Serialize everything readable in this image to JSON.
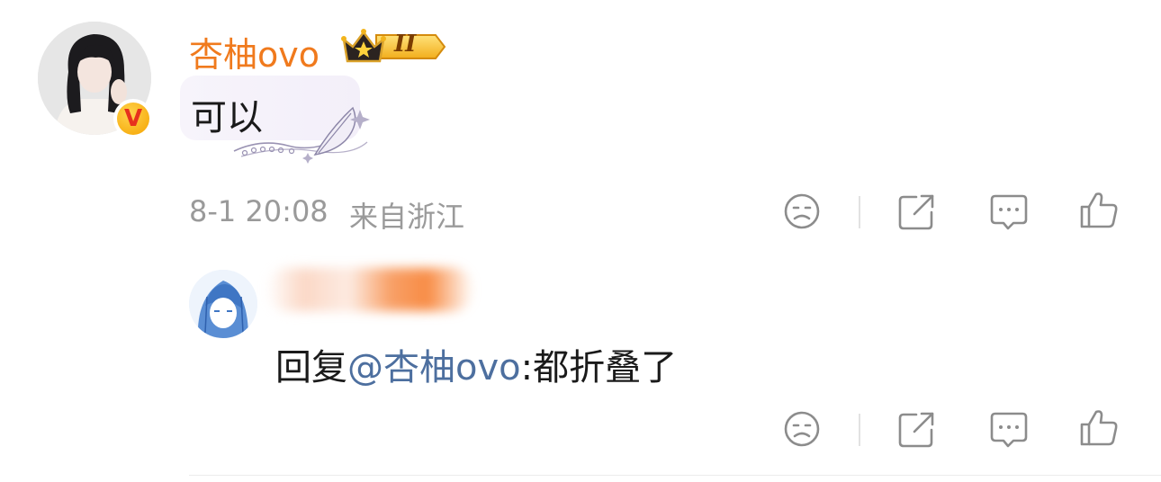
{
  "comment": {
    "author": "杏柚ovo",
    "rank_badge": "II",
    "vip_badge": "V",
    "text": "可以",
    "date": "8-1 20:08",
    "location": "来自浙江"
  },
  "reply": {
    "prefix": "回复",
    "mention": "@杏柚ovo",
    "text": ":都折叠了"
  },
  "actions": [
    "dislike-icon",
    "share-icon",
    "comment-icon",
    "like-icon"
  ],
  "colors": {
    "username": "#f07a1d",
    "mention": "#4d6f9f",
    "meta": "#9a9a9a",
    "icon": "#8c8c8c"
  }
}
